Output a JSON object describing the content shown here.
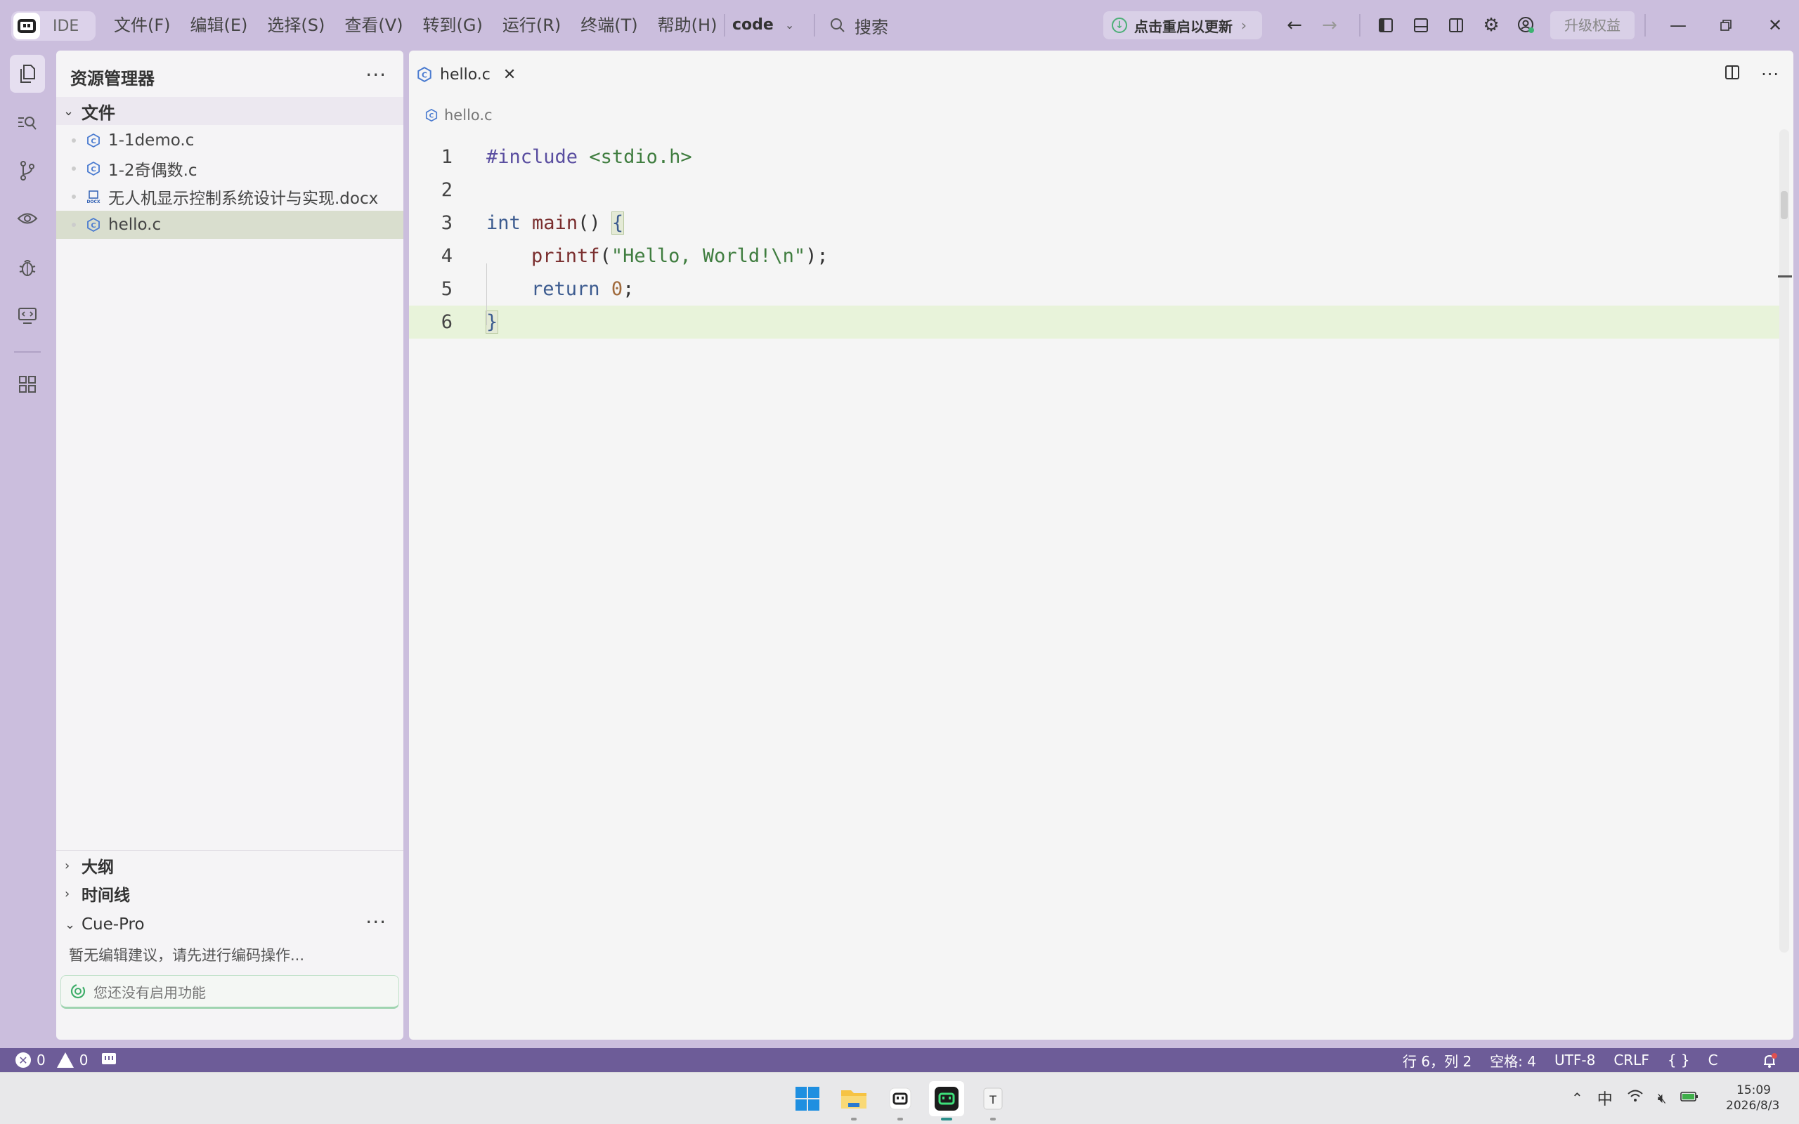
{
  "titlebar": {
    "app_name": "IDE",
    "menu": [
      "文件(F)",
      "编辑(E)",
      "选择(S)",
      "查看(V)",
      "转到(G)",
      "运行(R)",
      "终端(T)",
      "帮助(H)"
    ],
    "project": "code",
    "search_label": "搜索",
    "update_label": "点击重启以更新",
    "upgrade_label": "升级权益"
  },
  "sidebar": {
    "title": "资源管理器",
    "folder": "文件",
    "files": [
      {
        "name": "1-1demo.c",
        "type": "c"
      },
      {
        "name": "1-2奇偶数.c",
        "type": "c"
      },
      {
        "name": "无人机显示控制系统设计与实现.docx",
        "type": "docx"
      },
      {
        "name": "hello.c",
        "type": "c",
        "selected": true
      }
    ],
    "sections": {
      "outline": "大纲",
      "timeline": "时间线",
      "cue_pro": "Cue-Pro"
    },
    "cue_hint": "暂无编辑建议，请先进行编码操作...",
    "cue_status": "您还没有启用功能"
  },
  "editor": {
    "tab_label": "hello.c",
    "breadcrumb": "hello.c",
    "line_numbers": [
      "1",
      "2",
      "3",
      "4",
      "5",
      "6"
    ],
    "lines": {
      "l1": {
        "pre": "#include",
        "inc": "<stdio.h>"
      },
      "l3": {
        "type": "int",
        "fn": "main",
        "paren": "()",
        "brace": "{"
      },
      "l4": {
        "fn": "printf",
        "open": "(",
        "str": "\"Hello, World!\\n\"",
        "close": ");"
      },
      "l5": {
        "kw": "return",
        "num": "0",
        "semi": ";"
      },
      "l6": {
        "brace": "}"
      }
    },
    "current_line": 6
  },
  "statusbar": {
    "errors": "0",
    "warnings": "0",
    "position": "行 6，列 2",
    "spaces": "空格: 4",
    "encoding": "UTF-8",
    "eol": "CRLF",
    "braces": "{ }",
    "language": "C"
  },
  "taskbar": {
    "ime": "中",
    "time": "15:09",
    "date": "2026/8/3"
  },
  "colors": {
    "titlebar_bg": "#cbbedd",
    "statusbar_bg": "#6d5c98",
    "current_line_bg": "#e8f3da",
    "accent_green": "#4caf77"
  }
}
